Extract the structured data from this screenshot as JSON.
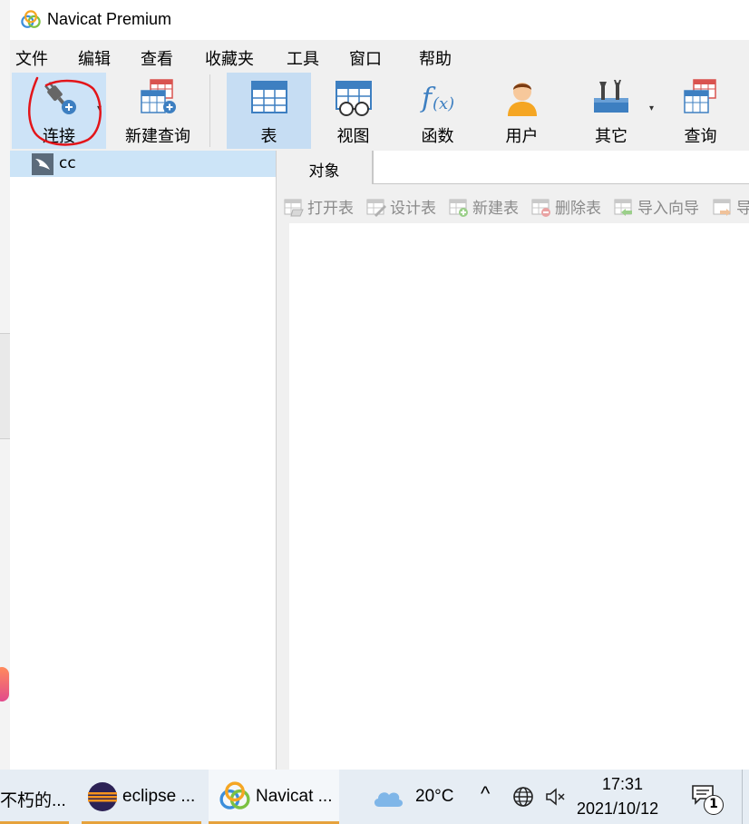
{
  "window": {
    "title": "Navicat Premium"
  },
  "menubar": {
    "items": [
      "文件",
      "编辑",
      "查看",
      "收藏夹",
      "工具",
      "窗口",
      "帮助"
    ]
  },
  "toolbar": {
    "connect_label": "连接",
    "new_query_label": "新建查询",
    "table_label": "表",
    "view_label": "视图",
    "function_label": "函数",
    "user_label": "用户",
    "other_label": "其它",
    "query_label": "查询",
    "dropdown_glyph": "▾"
  },
  "navigation": {
    "connections": [
      {
        "name": "cc"
      }
    ]
  },
  "objects": {
    "tab_label": "对象",
    "actions": {
      "open_table": "打开表",
      "design_table": "设计表",
      "new_table": "新建表",
      "delete_table": "删除表",
      "import_wizard": "导入向导",
      "export_wizard": "导"
    }
  },
  "taskbar": {
    "items": [
      {
        "label": "不朽的..."
      },
      {
        "label": "eclipse ..."
      },
      {
        "label": "Navicat ..."
      }
    ],
    "weather": {
      "temperature": "20°C"
    },
    "clock": {
      "time": "17:31",
      "date": "2021/10/12"
    },
    "notification_count": "1",
    "tray_up_glyph": "^"
  },
  "colors": {
    "accent_blue": "#3d7fc1",
    "selection": "#cce4f7",
    "annotation_red": "#e3151a",
    "taskbar_underline": "#e6a23c"
  }
}
